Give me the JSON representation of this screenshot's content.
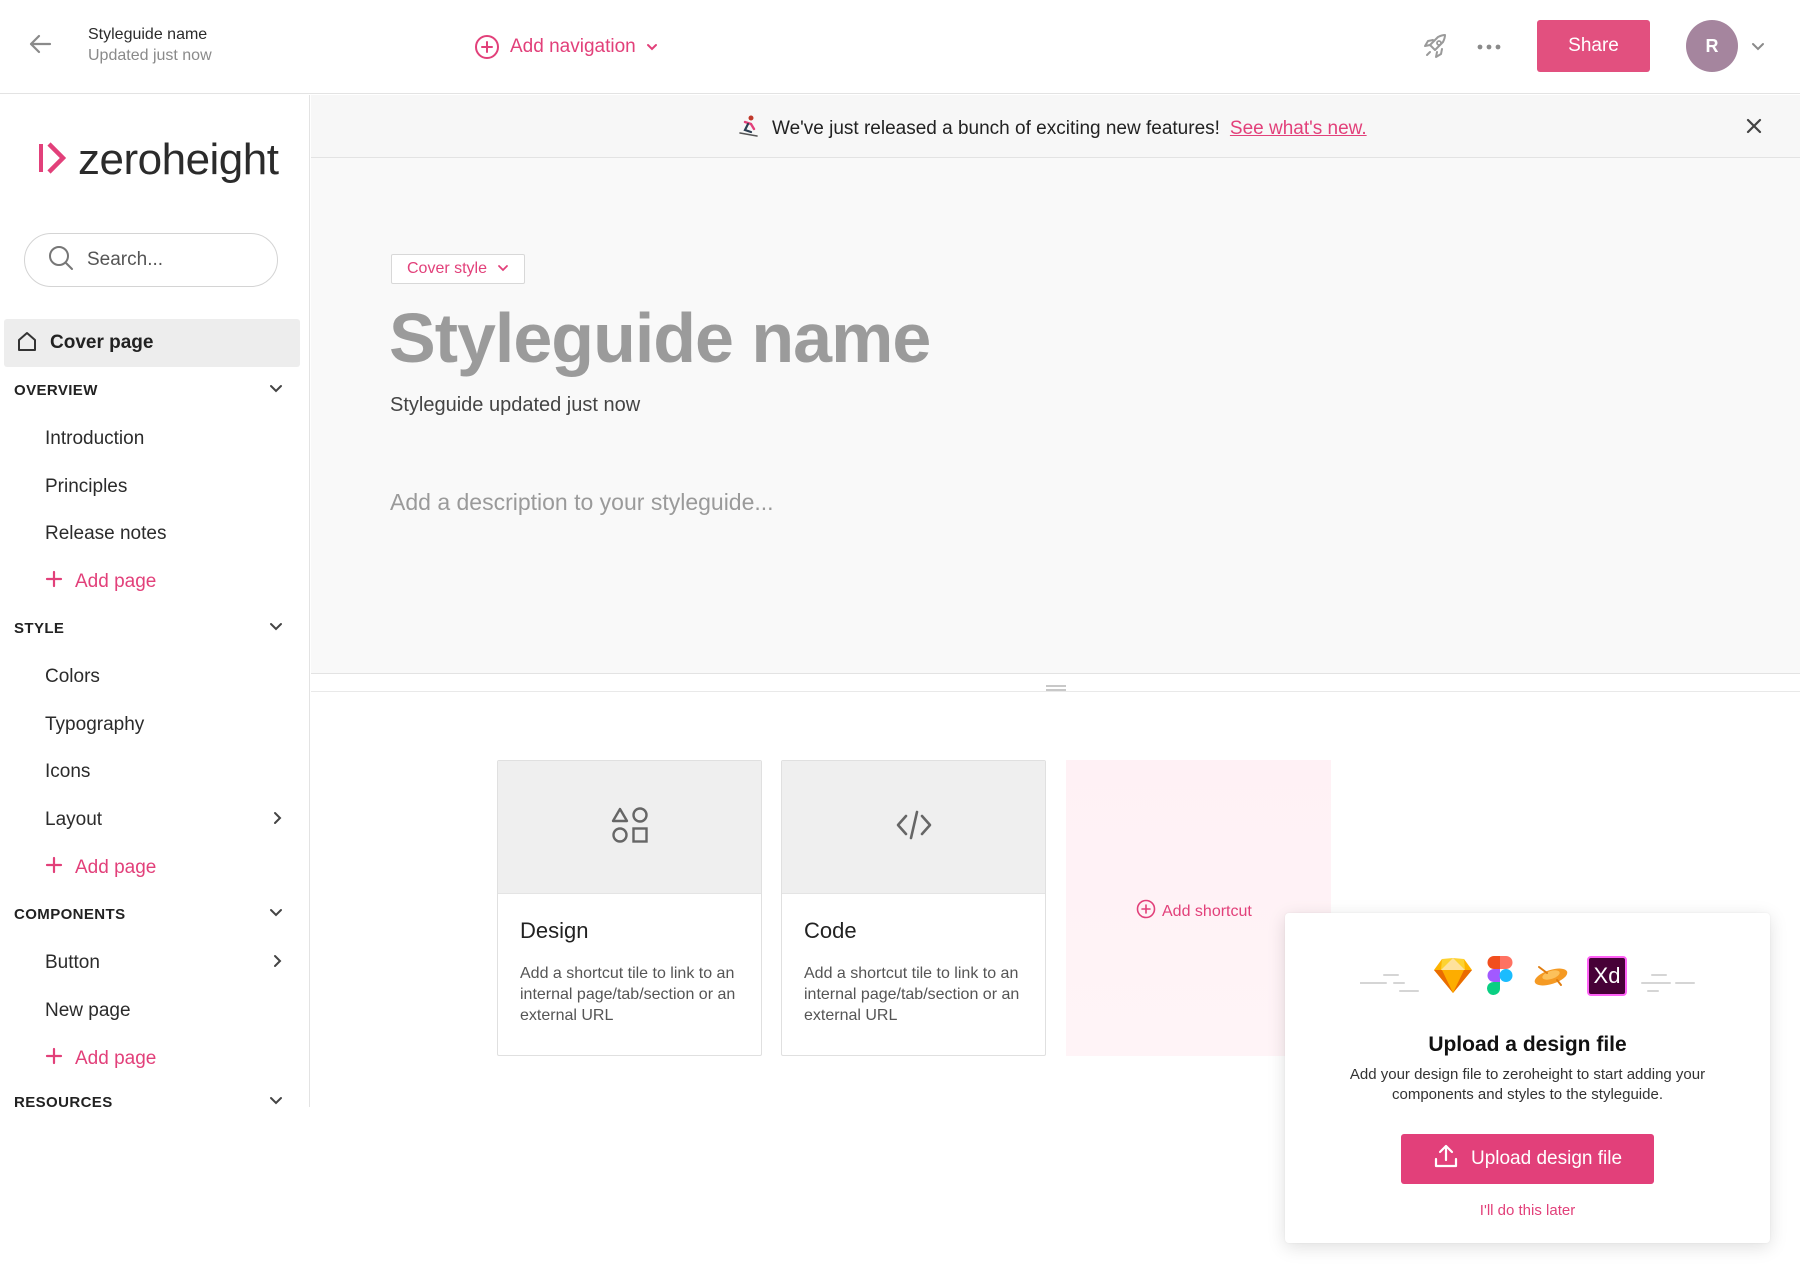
{
  "colors": {
    "accent": "#e2407a",
    "share_bg": "#e2507f",
    "avatar_bg": "#a5859e"
  },
  "header": {
    "doc_title": "Styleguide name",
    "doc_status": "Updated just now",
    "add_navigation_label": "Add navigation",
    "share_label": "Share",
    "avatar_initial": "R",
    "icons": [
      "back-arrow-icon",
      "plus-circle-icon",
      "chevron-down-icon",
      "rocket-icon",
      "more-icon"
    ]
  },
  "sidebar": {
    "logo_text": "zeroheight",
    "search_placeholder": "Search...",
    "cover_page_label": "Cover page",
    "sections": [
      {
        "label": "OVERVIEW",
        "items": [
          "Introduction",
          "Principles",
          "Release notes"
        ]
      },
      {
        "label": "STYLE",
        "items": [
          "Colors",
          "Typography",
          "Icons",
          "Layout"
        ]
      },
      {
        "label": "COMPONENTS",
        "items": [
          "Button",
          "New page"
        ]
      },
      {
        "label": "RESOURCES",
        "items": []
      }
    ],
    "add_page_label": "Add page"
  },
  "banner": {
    "text": "We've just released a bunch of exciting new features!",
    "link": "See what's new."
  },
  "cover": {
    "style_button_label": "Cover style",
    "title": "Styleguide name",
    "updated_text": "Styleguide updated just now",
    "description_placeholder": "Add a description to your styleguide..."
  },
  "tiles": [
    {
      "title": "Design",
      "description": "Add a shortcut tile to link to an internal page/tab/section or an external URL",
      "icon": "shapes-icon"
    },
    {
      "title": "Code",
      "description": "Add a shortcut tile to link to an internal page/tab/section or an external URL",
      "icon": "code-icon"
    }
  ],
  "add_shortcut_label": "Add shortcut",
  "upload_popup": {
    "title": "Upload a design file",
    "description": "Add your design file to zeroheight to start adding your components and styles to the styleguide.",
    "button_label": "Upload design file",
    "later_label": "I'll do this later",
    "tool_icons": [
      "sketch-icon",
      "figma-icon",
      "abstract-icon",
      "xd-icon"
    ],
    "xd_label": "Xd"
  }
}
